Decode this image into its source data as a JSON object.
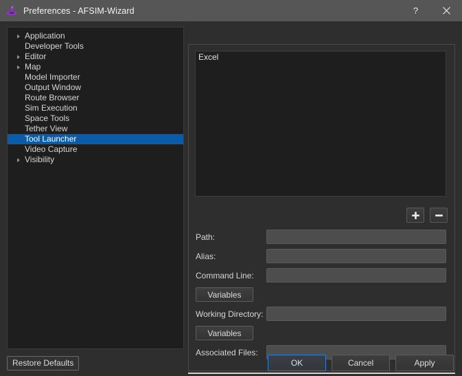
{
  "window": {
    "title": "Preferences - AFSIM-Wizard",
    "app_icon": "wizard-hat-icon",
    "help_label": "?",
    "close_label": "✕"
  },
  "colors": {
    "selection": "#0a5ba8",
    "default_button_border": "#2a7fd4",
    "titlebar": "#565656",
    "panel_bg": "#2e2e2e",
    "list_bg": "#1e1e1e",
    "field_bg": "#4d4d4d"
  },
  "sidebar": {
    "items": [
      {
        "label": "Application",
        "expandable": true,
        "selected": false
      },
      {
        "label": "Developer Tools",
        "expandable": false,
        "selected": false
      },
      {
        "label": "Editor",
        "expandable": true,
        "selected": false
      },
      {
        "label": "Map",
        "expandable": true,
        "selected": false
      },
      {
        "label": "Model Importer",
        "expandable": false,
        "selected": false
      },
      {
        "label": "Output Window",
        "expandable": false,
        "selected": false
      },
      {
        "label": "Route Browser",
        "expandable": false,
        "selected": false
      },
      {
        "label": "Sim Execution",
        "expandable": false,
        "selected": false
      },
      {
        "label": "Space Tools",
        "expandable": false,
        "selected": false
      },
      {
        "label": "Tether View",
        "expandable": false,
        "selected": false
      },
      {
        "label": "Tool Launcher",
        "expandable": false,
        "selected": true
      },
      {
        "label": "Video Capture",
        "expandable": false,
        "selected": false
      },
      {
        "label": "Visibility",
        "expandable": true,
        "selected": false
      }
    ]
  },
  "main": {
    "tool_list": {
      "items": [
        {
          "label": "Excel"
        }
      ]
    },
    "list_buttons": {
      "add": {
        "icon": "plus-icon",
        "label": "+"
      },
      "remove": {
        "icon": "minus-icon",
        "label": "−"
      }
    },
    "fields": [
      {
        "label": "Path:",
        "value": "",
        "placeholder": ""
      },
      {
        "label": "Alias:",
        "value": "",
        "placeholder": ""
      },
      {
        "label": "Command Line:",
        "value": "",
        "placeholder": ""
      }
    ],
    "command_variables_button": "Variables",
    "working_directory": {
      "label": "Working Directory:",
      "value": "",
      "placeholder": ""
    },
    "working_variables_button": "Variables",
    "associated_files": {
      "label": "Associated Files:",
      "value": "",
      "placeholder": ""
    }
  },
  "footer": {
    "restore_defaults": "Restore Defaults",
    "ok": "OK",
    "cancel": "Cancel",
    "apply": "Apply"
  }
}
